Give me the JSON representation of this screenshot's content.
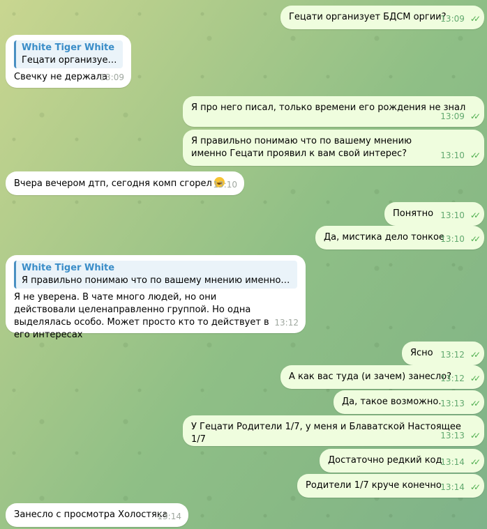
{
  "messages": [
    {
      "text": "Гецати организует БДСМ оргии?",
      "time": "13:09"
    },
    {
      "reply_name": "White Tiger White",
      "reply_text": "Гецати организует БДС...",
      "text": "Свечку не держала",
      "time": "13:09"
    },
    {
      "text": "Я про него писал, только времени его рождения не знал",
      "time": "13:09"
    },
    {
      "text": "Я правильно понимаю что по вашему мнению именно Гецати проявил к вам свой интерес?",
      "time": "13:10"
    },
    {
      "text": "Вчера вечером дтп, сегодня комп сгорел",
      "time": "13:10",
      "emoji": "joy-emoji"
    },
    {
      "text": "Понятно",
      "time": "13:10"
    },
    {
      "text": "Да, мистика дело тонкое",
      "time": "13:10"
    },
    {
      "reply_name": "White Tiger White",
      "reply_text": "Я правильно понимаю что по вашему мнению именно Гецати...",
      "text": "Я не уверена. В чате много людей, но они действовали целенаправленно группой. Но одна выделялась особо. Может просто кто то действует в его интересах",
      "time": "13:12"
    },
    {
      "text": "Ясно",
      "time": "13:12"
    },
    {
      "text": "А как вас туда (и зачем) занесло?",
      "time": "13:12"
    },
    {
      "text": "Да, такое возможно.",
      "time": "13:13"
    },
    {
      "text": "У Гецати Родители 1/7, у меня и Блаватской Настоящее 1/7",
      "time": "13:13"
    },
    {
      "text": "Достаточно редкий код",
      "time": "13:14"
    },
    {
      "text": "Родители 1/7 круче конечно",
      "time": "13:14"
    },
    {
      "text": "Занесло с просмотра Холостяка",
      "time": "13:14"
    }
  ],
  "icons": {
    "read_status": "double-check-icon"
  }
}
